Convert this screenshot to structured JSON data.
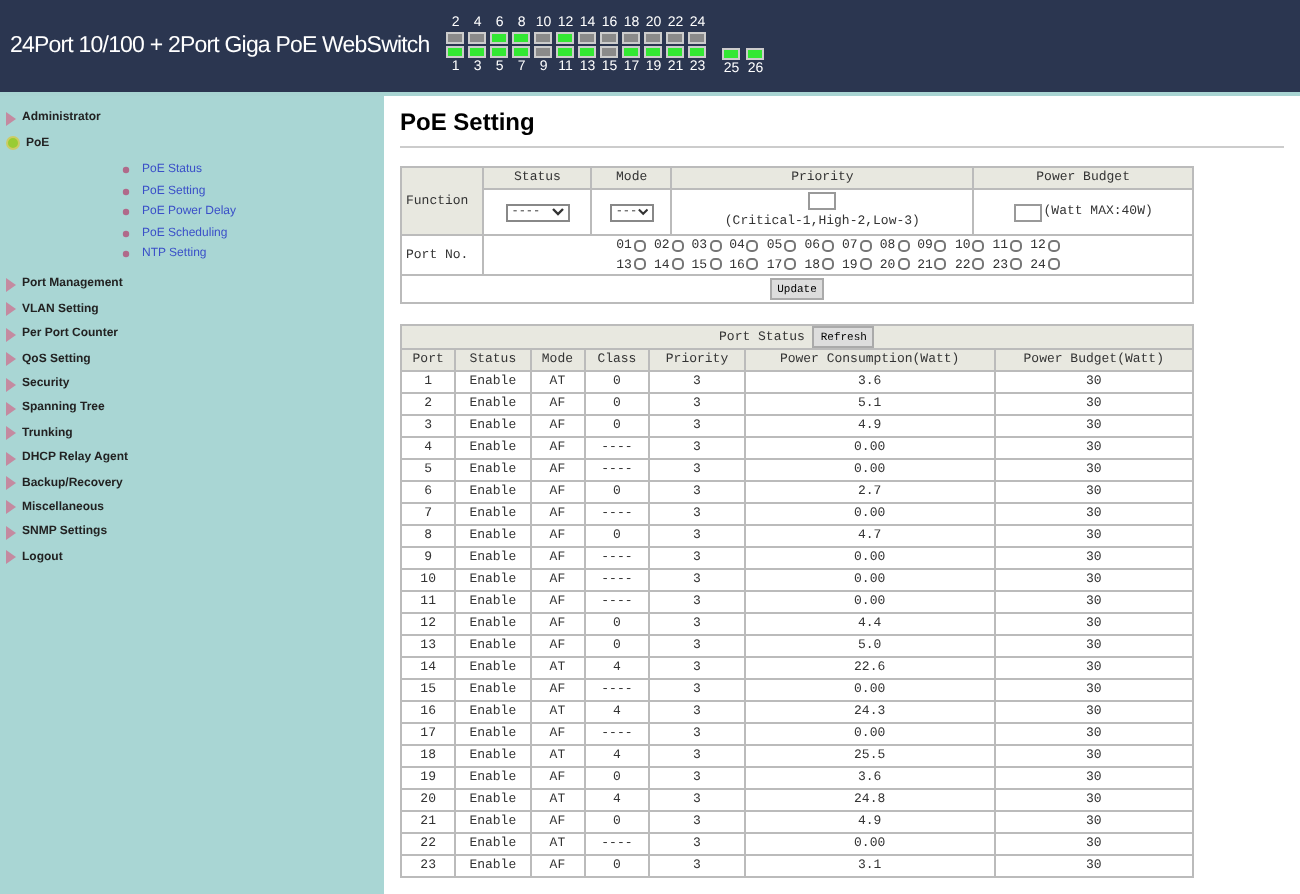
{
  "header": {
    "title": "24Port 10/100 + 2Port Giga PoE WebSwitch",
    "port_leds": {
      "top": [
        {
          "label": "2",
          "on": false
        },
        {
          "label": "4",
          "on": false
        },
        {
          "label": "6",
          "on": true
        },
        {
          "label": "8",
          "on": true
        },
        {
          "label": "10",
          "on": false
        },
        {
          "label": "12",
          "on": true
        },
        {
          "label": "14",
          "on": false
        },
        {
          "label": "16",
          "on": false
        },
        {
          "label": "18",
          "on": false
        },
        {
          "label": "20",
          "on": false
        },
        {
          "label": "22",
          "on": false
        },
        {
          "label": "24",
          "on": false
        }
      ],
      "bottom": [
        {
          "label": "1",
          "on": true
        },
        {
          "label": "3",
          "on": true
        },
        {
          "label": "5",
          "on": true
        },
        {
          "label": "7",
          "on": true
        },
        {
          "label": "9",
          "on": false
        },
        {
          "label": "11",
          "on": true
        },
        {
          "label": "13",
          "on": true
        },
        {
          "label": "15",
          "on": false
        },
        {
          "label": "17",
          "on": true
        },
        {
          "label": "19",
          "on": true
        },
        {
          "label": "21",
          "on": true
        },
        {
          "label": "23",
          "on": true
        }
      ],
      "uplinks": [
        {
          "label": "25",
          "on": true
        },
        {
          "label": "26",
          "on": true
        }
      ]
    }
  },
  "sidebar": {
    "items": [
      {
        "label": "Administrator",
        "expanded": false
      },
      {
        "label": "PoE",
        "expanded": true,
        "children": [
          {
            "label": "PoE Status"
          },
          {
            "label": "PoE Setting"
          },
          {
            "label": "PoE Power Delay"
          },
          {
            "label": "PoE Scheduling"
          },
          {
            "label": "NTP Setting"
          }
        ]
      },
      {
        "label": "Port Management",
        "expanded": false
      },
      {
        "label": "VLAN Setting",
        "expanded": false
      },
      {
        "label": "Per Port Counter",
        "expanded": false
      },
      {
        "label": "QoS Setting",
        "expanded": false
      },
      {
        "label": "Security",
        "expanded": false
      },
      {
        "label": "Spanning Tree",
        "expanded": false
      },
      {
        "label": "Trunking",
        "expanded": false
      },
      {
        "label": "DHCP Relay Agent",
        "expanded": false
      },
      {
        "label": "Backup/Recovery",
        "expanded": false
      },
      {
        "label": "Miscellaneous",
        "expanded": false
      },
      {
        "label": "SNMP Settings",
        "expanded": false
      },
      {
        "label": "Logout",
        "expanded": false
      }
    ]
  },
  "page_title": "PoE Setting",
  "setting_table": {
    "row_label": "Function",
    "columns": [
      "Status",
      "Mode",
      "Priority",
      "Power Budget"
    ],
    "status_select": "----",
    "mode_select": "---",
    "priority_hint": "(Critical-1,High-2,Low-3)",
    "budget_hint": "(Watt MAX:40W)",
    "port_label": "Port No.",
    "ports": [
      {
        "label": "01",
        "checked": false
      },
      {
        "label": "02",
        "checked": false
      },
      {
        "label": "03",
        "checked": false
      },
      {
        "label": "04",
        "checked": false
      },
      {
        "label": "05",
        "checked": false
      },
      {
        "label": "06",
        "checked": false
      },
      {
        "label": "07",
        "checked": false
      },
      {
        "label": "08",
        "checked": false
      },
      {
        "label": "09",
        "checked": false
      },
      {
        "label": "10",
        "checked": false
      },
      {
        "label": "11",
        "checked": false
      },
      {
        "label": "12",
        "checked": false
      },
      {
        "label": "13",
        "checked": false
      },
      {
        "label": "14",
        "checked": false
      },
      {
        "label": "15",
        "checked": false
      },
      {
        "label": "16",
        "checked": false
      },
      {
        "label": "17",
        "checked": false
      },
      {
        "label": "18",
        "checked": false
      },
      {
        "label": "19",
        "checked": false
      },
      {
        "label": "20",
        "checked": false
      },
      {
        "label": "21",
        "checked": false
      },
      {
        "label": "22",
        "checked": false
      },
      {
        "label": "23",
        "checked": false
      },
      {
        "label": "24",
        "checked": false
      }
    ],
    "update_button": "Update"
  },
  "port_status": {
    "title": "Port Status",
    "refresh_button": "Refresh",
    "columns": [
      "Port",
      "Status",
      "Mode",
      "Class",
      "Priority",
      "Power Consumption(Watt)",
      "Power Budget(Watt)"
    ],
    "rows": [
      [
        "1",
        "Enable",
        "AT",
        "0",
        "3",
        "3.6",
        "30"
      ],
      [
        "2",
        "Enable",
        "AF",
        "0",
        "3",
        "5.1",
        "30"
      ],
      [
        "3",
        "Enable",
        "AF",
        "0",
        "3",
        "4.9",
        "30"
      ],
      [
        "4",
        "Enable",
        "AF",
        "----",
        "3",
        "0.00",
        "30"
      ],
      [
        "5",
        "Enable",
        "AF",
        "----",
        "3",
        "0.00",
        "30"
      ],
      [
        "6",
        "Enable",
        "AF",
        "0",
        "3",
        "2.7",
        "30"
      ],
      [
        "7",
        "Enable",
        "AF",
        "----",
        "3",
        "0.00",
        "30"
      ],
      [
        "8",
        "Enable",
        "AF",
        "0",
        "3",
        "4.7",
        "30"
      ],
      [
        "9",
        "Enable",
        "AF",
        "----",
        "3",
        "0.00",
        "30"
      ],
      [
        "10",
        "Enable",
        "AF",
        "----",
        "3",
        "0.00",
        "30"
      ],
      [
        "11",
        "Enable",
        "AF",
        "----",
        "3",
        "0.00",
        "30"
      ],
      [
        "12",
        "Enable",
        "AF",
        "0",
        "3",
        "4.4",
        "30"
      ],
      [
        "13",
        "Enable",
        "AF",
        "0",
        "3",
        "5.0",
        "30"
      ],
      [
        "14",
        "Enable",
        "AT",
        "4",
        "3",
        "22.6",
        "30"
      ],
      [
        "15",
        "Enable",
        "AF",
        "----",
        "3",
        "0.00",
        "30"
      ],
      [
        "16",
        "Enable",
        "AT",
        "4",
        "3",
        "24.3",
        "30"
      ],
      [
        "17",
        "Enable",
        "AF",
        "----",
        "3",
        "0.00",
        "30"
      ],
      [
        "18",
        "Enable",
        "AT",
        "4",
        "3",
        "25.5",
        "30"
      ],
      [
        "19",
        "Enable",
        "AF",
        "0",
        "3",
        "3.6",
        "30"
      ],
      [
        "20",
        "Enable",
        "AT",
        "4",
        "3",
        "24.8",
        "30"
      ],
      [
        "21",
        "Enable",
        "AF",
        "0",
        "3",
        "4.9",
        "30"
      ],
      [
        "22",
        "Enable",
        "AT",
        "----",
        "3",
        "0.00",
        "30"
      ],
      [
        "23",
        "Enable",
        "AF",
        "0",
        "3",
        "3.1",
        "30"
      ]
    ]
  }
}
